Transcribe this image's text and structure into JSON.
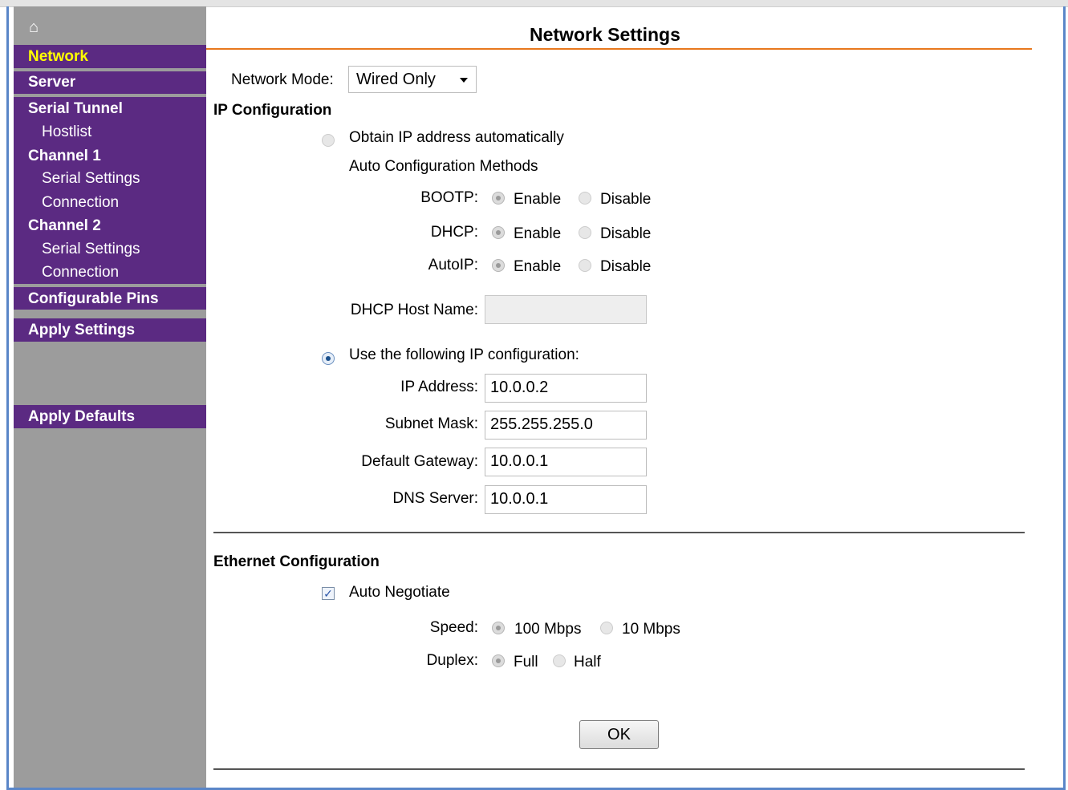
{
  "page_title": "Network Settings",
  "colors": {
    "nav_bg": "#5b2a82",
    "nav_active_text": "#ffff00",
    "sidebar_bg": "#9c9c9c",
    "title_rule": "#e8781e"
  },
  "sidebar": {
    "home_icon": "⌂",
    "items": [
      {
        "label": "Network"
      },
      {
        "label": "Server"
      },
      {
        "label": "Serial Tunnel"
      },
      {
        "label": "Hostlist"
      },
      {
        "label": "Channel 1"
      },
      {
        "label": "Serial Settings"
      },
      {
        "label": "Connection"
      },
      {
        "label": "Channel 2"
      },
      {
        "label": "Serial Settings"
      },
      {
        "label": "Connection"
      },
      {
        "label": "Configurable Pins"
      },
      {
        "label": "Apply Settings"
      },
      {
        "label": "Apply Defaults"
      }
    ]
  },
  "network_mode": {
    "label": "Network Mode:",
    "value": "Wired Only"
  },
  "ip_config": {
    "heading": "IP Configuration",
    "auto_label": "Obtain IP address automatically",
    "auto_methods_label": "Auto Configuration Methods",
    "enable_label": "Enable",
    "disable_label": "Disable",
    "bootp_label": "BOOTP:",
    "dhcp_label": "DHCP:",
    "autoip_label": "AutoIP:",
    "dhcp_host_label": "DHCP Host Name:",
    "dhcp_host_value": "",
    "manual_label": "Use the following IP configuration:",
    "ip_label": "IP Address:",
    "ip_value": "10.0.0.2",
    "subnet_label": "Subnet Mask:",
    "subnet_value": "255.255.255.0",
    "gateway_label": "Default Gateway:",
    "gateway_value": "10.0.0.1",
    "dns_label": "DNS Server:",
    "dns_value": "10.0.0.1"
  },
  "ethernet": {
    "heading": "Ethernet Configuration",
    "auto_negotiate_label": "Auto Negotiate",
    "speed_label": "Speed:",
    "speed_100": "100 Mbps",
    "speed_10": "10 Mbps",
    "duplex_label": "Duplex:",
    "duplex_full": "Full",
    "duplex_half": "Half"
  },
  "ok_label": "OK"
}
